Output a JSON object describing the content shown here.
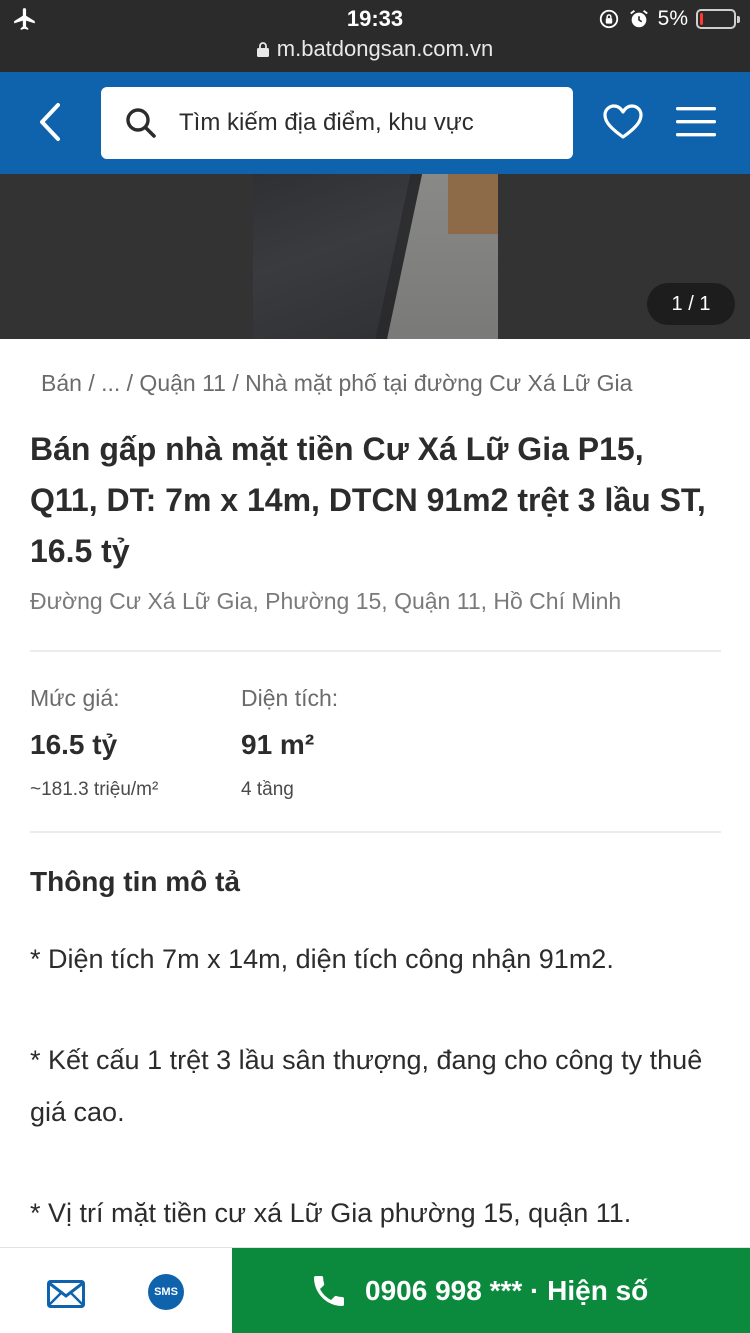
{
  "status_bar": {
    "time": "19:33",
    "battery_text": "5%",
    "battery_level": 0.05,
    "url": "m.batdongsan.com.vn"
  },
  "header": {
    "search_placeholder": "Tìm kiếm địa điểm, khu vực"
  },
  "gallery": {
    "counter": "1 / 1"
  },
  "listing": {
    "breadcrumb": "Bán / ... / Quận 11 / Nhà mặt phố tại đường Cư Xá Lữ Gia",
    "title": "Bán gấp nhà mặt tiền Cư Xá Lữ Gia P15, Q11, DT: 7m x 14m, DTCN 91m2 trệt 3 lầu ST, 16.5 tỷ",
    "address": "Đường Cư Xá Lữ Gia, Phường 15, Quận 11, Hồ Chí Minh",
    "price": {
      "label": "Mức giá:",
      "value": "16.5 tỷ",
      "sub": "~181.3 triệu/m²"
    },
    "area": {
      "label": "Diện tích:",
      "value": "91 m²",
      "sub": "4 tầng"
    },
    "description_title": "Thông tin mô tả",
    "description": [
      "* Diện tích 7m x 14m, diện tích công nhận 91m2.",
      "* Kết cấu 1 trệt 3 lầu sân thượng, đang cho công ty thuê giá cao.",
      "* Vị trí mặt tiền cư xá Lữ Gia phường 15, quận 11."
    ]
  },
  "bottom_bar": {
    "sms_label": "SMS",
    "call_label": "0906 998 *** · Hiện số"
  },
  "colors": {
    "header_blue": "#0f63ad",
    "call_green": "#0b8a3e",
    "status_bar": "#2b2b2b"
  },
  "icons": [
    "airplane-icon",
    "lock-icon",
    "alarm-icon",
    "rotation-lock-icon",
    "battery-icon",
    "back-icon",
    "search-icon",
    "heart-icon",
    "menu-icon",
    "mail-icon",
    "sms-icon",
    "phone-icon"
  ]
}
